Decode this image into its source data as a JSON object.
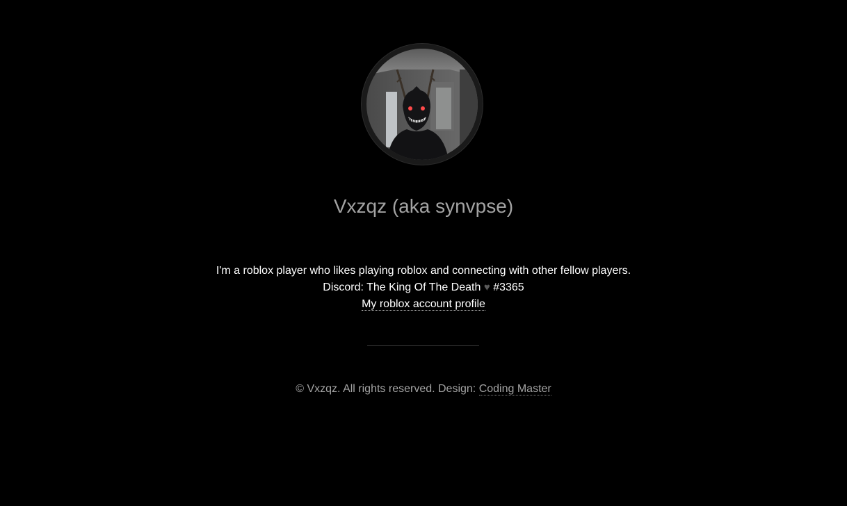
{
  "profile": {
    "name": "Vxzqz (aka synvpse)",
    "avatar_icon": "demon-avatar"
  },
  "bio": {
    "line1": "I'm a roblox player who likes playing roblox and connecting with other fellow players.",
    "discord_prefix": "Discord: The King Of The Death",
    "discord_heart": "♥",
    "discord_tag": "#3365",
    "profile_link": "My roblox account profile"
  },
  "footer": {
    "copyright": "© Vxzqz. All rights reserved. Design:",
    "design_link": "Coding Master"
  },
  "colors": {
    "background": "#000000",
    "name": "#a3a3a3",
    "text": "#ffffff",
    "footer": "#a3a3a3"
  }
}
